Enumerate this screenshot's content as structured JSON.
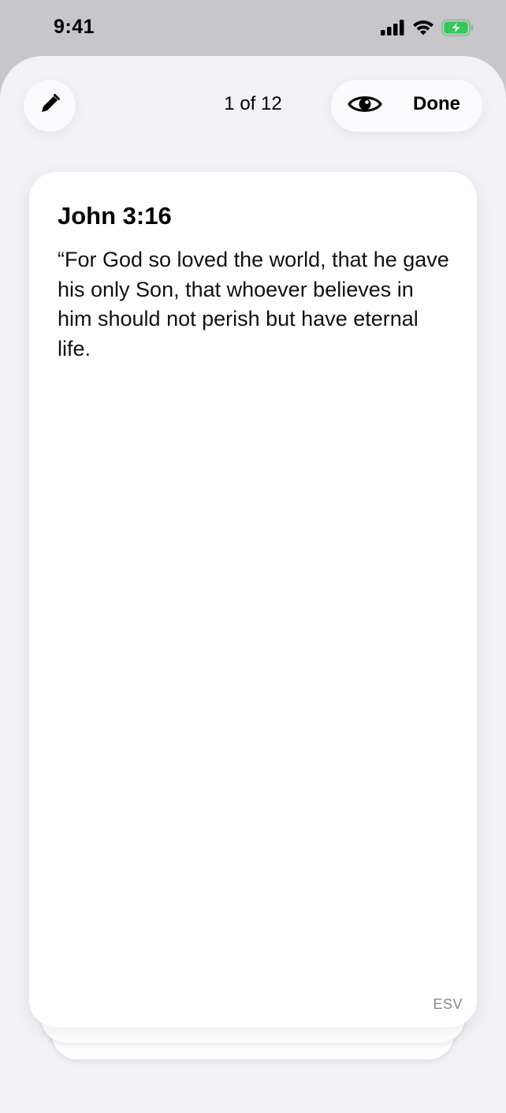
{
  "status_bar": {
    "time": "9:41"
  },
  "toolbar": {
    "page_counter": "1 of 12",
    "done_label": "Done"
  },
  "card": {
    "title": "John 3:16",
    "body": "“For God so loved the world, that he gave his only Son, that whoever believes in him should not perish but have eternal life.",
    "translation": "ESV"
  },
  "icons": {
    "edit": "pencil-icon",
    "preview": "eye-icon",
    "signal": "signal-icon",
    "wifi": "wifi-icon",
    "battery": "battery-charging-icon"
  },
  "colors": {
    "battery_fill": "#34c759",
    "sheet_background": "#f1f1f6",
    "card_background": "#ffffff",
    "translation_text": "#8a8a8e"
  }
}
